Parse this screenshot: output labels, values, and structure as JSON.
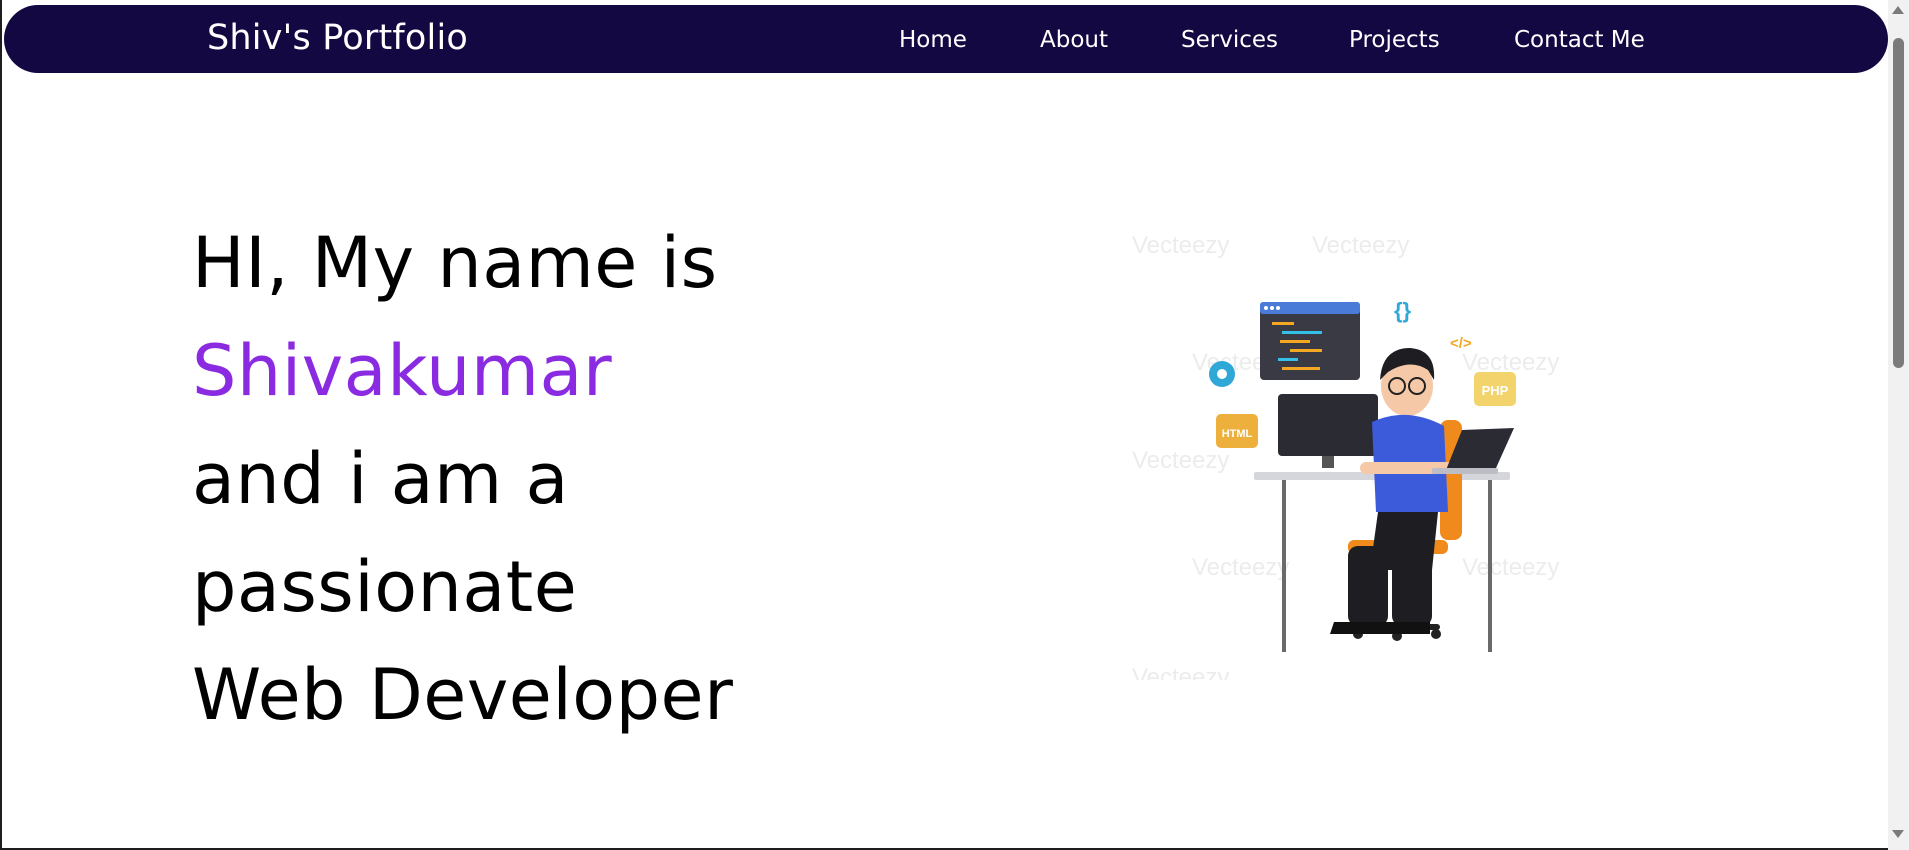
{
  "navbar": {
    "brand": "Shiv's Portfolio",
    "links": [
      "Home",
      "About",
      "Services",
      "Projects",
      "Contact Me"
    ]
  },
  "hero": {
    "line1": "HI, My name is",
    "name": "Shivakumar",
    "line3": "and i am a",
    "line4": "passionate",
    "line5": "Web Developer"
  },
  "illustration": {
    "tags": [
      "{}",
      "</>",
      "PHP",
      "HTML"
    ],
    "watermark": "Vecteezy"
  },
  "colors": {
    "navbar_bg": "#140842",
    "accent": "#8a2be2"
  }
}
